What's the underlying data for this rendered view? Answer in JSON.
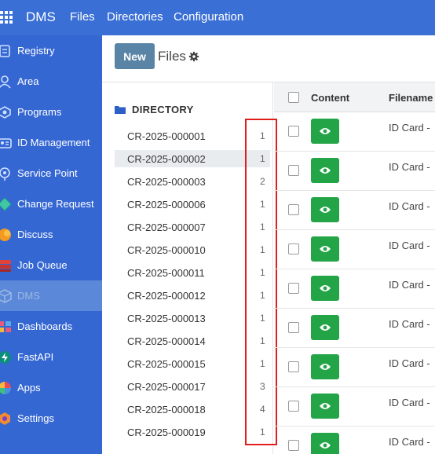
{
  "topbar": {
    "brand": "DMS",
    "menu": [
      "Files",
      "Directories",
      "Configuration"
    ]
  },
  "sidebar": {
    "items": [
      {
        "label": "Registry",
        "icon": "registry-icon"
      },
      {
        "label": "Area",
        "icon": "area-icon"
      },
      {
        "label": "Programs",
        "icon": "programs-icon"
      },
      {
        "label": "ID Management",
        "icon": "id-card-icon"
      },
      {
        "label": "Service Point",
        "icon": "service-point-icon"
      },
      {
        "label": "Change Request",
        "icon": "change-request-icon"
      },
      {
        "label": "Discuss",
        "icon": "discuss-icon"
      },
      {
        "label": "Job Queue",
        "icon": "job-queue-icon"
      },
      {
        "label": "DMS",
        "icon": "dms-icon",
        "active": true
      },
      {
        "label": "Dashboards",
        "icon": "dashboards-icon"
      },
      {
        "label": "FastAPI",
        "icon": "fastapi-icon"
      },
      {
        "label": "Apps",
        "icon": "apps-icon"
      },
      {
        "label": "Settings",
        "icon": "settings-icon"
      }
    ]
  },
  "control_panel": {
    "new_label": "New",
    "breadcrumb": "Files"
  },
  "directory": {
    "title": "DIRECTORY",
    "items": [
      {
        "name": "CR-2025-000001",
        "count": "1"
      },
      {
        "name": "CR-2025-000002",
        "count": "1",
        "selected": true
      },
      {
        "name": "CR-2025-000003",
        "count": "2"
      },
      {
        "name": "CR-2025-000006",
        "count": "1"
      },
      {
        "name": "CR-2025-000007",
        "count": "1"
      },
      {
        "name": "CR-2025-000010",
        "count": "1"
      },
      {
        "name": "CR-2025-000011",
        "count": "1"
      },
      {
        "name": "CR-2025-000012",
        "count": "1"
      },
      {
        "name": "CR-2025-000013",
        "count": "1"
      },
      {
        "name": "CR-2025-000014",
        "count": "1"
      },
      {
        "name": "CR-2025-000015",
        "count": "1"
      },
      {
        "name": "CR-2025-000017",
        "count": "3"
      },
      {
        "name": "CR-2025-000018",
        "count": "4"
      },
      {
        "name": "CR-2025-000019",
        "count": "1"
      }
    ]
  },
  "table": {
    "columns": [
      "Content",
      "Filename"
    ],
    "rows": [
      {
        "filename": "ID Card -"
      },
      {
        "filename": "ID Card -"
      },
      {
        "filename": "ID Card -"
      },
      {
        "filename": "ID Card -"
      },
      {
        "filename": "ID Card -"
      },
      {
        "filename": "ID Card -"
      },
      {
        "filename": "ID Card -"
      },
      {
        "filename": "ID Card -"
      },
      {
        "filename": "ID Card -"
      }
    ]
  },
  "colors": {
    "navbar": "#3a6fd6",
    "sidebar": "#3567d3",
    "new_button": "#5a84a6",
    "view_button": "#22a447",
    "highlight_box": "#e01e1e"
  }
}
